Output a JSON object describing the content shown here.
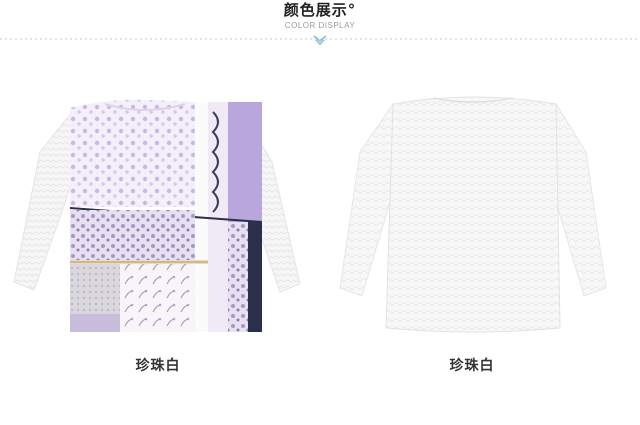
{
  "header": {
    "title": "颜色展示°",
    "subtitle": "COLOR DISPLAY"
  },
  "products": [
    {
      "color_label": "珍珠白",
      "view": "front-patchwork"
    },
    {
      "color_label": "珍珠白",
      "view": "back-plain"
    }
  ],
  "colors": {
    "accent": "#7cc5c9",
    "divider": "#c8c8c8",
    "lavender": "#b9a6dc",
    "navy": "#2a2f4a"
  }
}
